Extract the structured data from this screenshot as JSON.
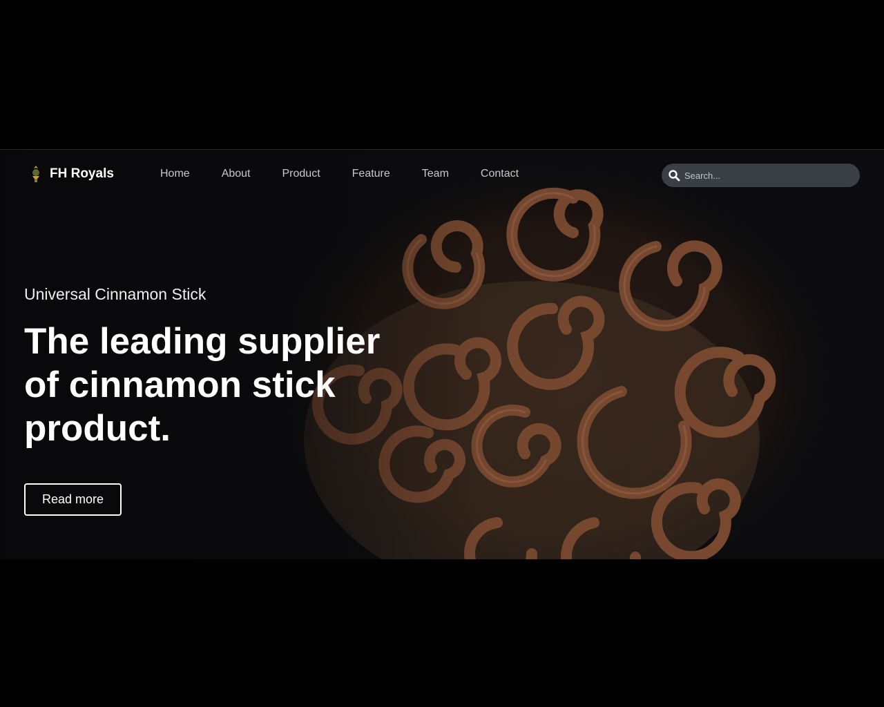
{
  "brand": {
    "name": "FH Royals",
    "logo_icon": "crest-logo-icon"
  },
  "nav": {
    "items": [
      {
        "label": "Home"
      },
      {
        "label": "About"
      },
      {
        "label": "Product"
      },
      {
        "label": "Feature"
      },
      {
        "label": "Team"
      },
      {
        "label": "Contact"
      }
    ]
  },
  "search": {
    "placeholder": "Search...",
    "icon": "search-icon"
  },
  "hero": {
    "kicker": "Universal Cinnamon Stick",
    "headline_lines": [
      "The leading supplier",
      "of cinnamon stick",
      "product."
    ],
    "cta_label": "Read more",
    "background": "cinnamon-sticks-photo"
  },
  "colors": {
    "page_background": "#000000",
    "hero_background": "#0c0c0e",
    "cinnamon": "#7a4a30",
    "search_background": "#3a3e45",
    "text_primary": "#ffffff",
    "nav_text": "#c9c9c9"
  }
}
